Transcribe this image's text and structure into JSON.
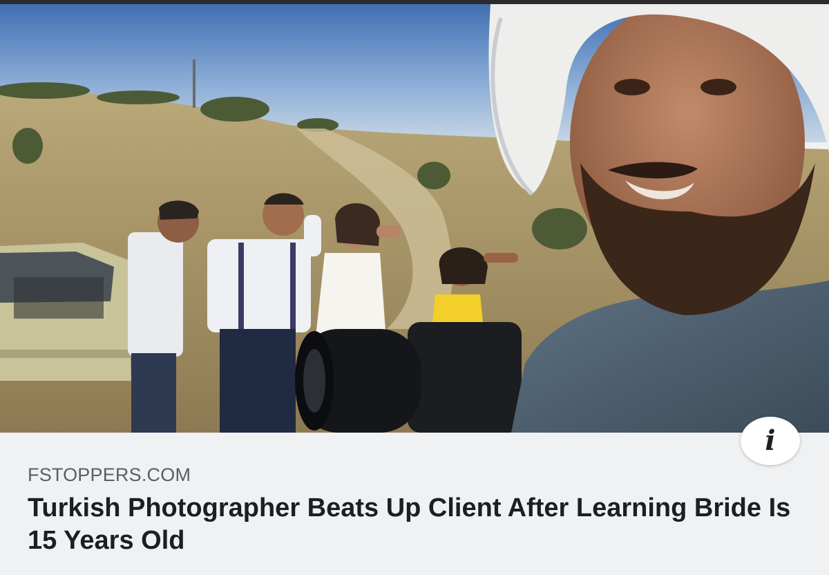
{
  "link_preview": {
    "source_domain": "FSTOPPERS.COM",
    "headline": "Turkish Photographer Beats Up Client After Learning Bride Is 15 Years Old",
    "info_icon": "info-icon",
    "info_glyph": "i"
  },
  "image": {
    "description_icon": "photo",
    "sky_color": "#7a9fd0",
    "ground_color": "#b8a77a"
  }
}
